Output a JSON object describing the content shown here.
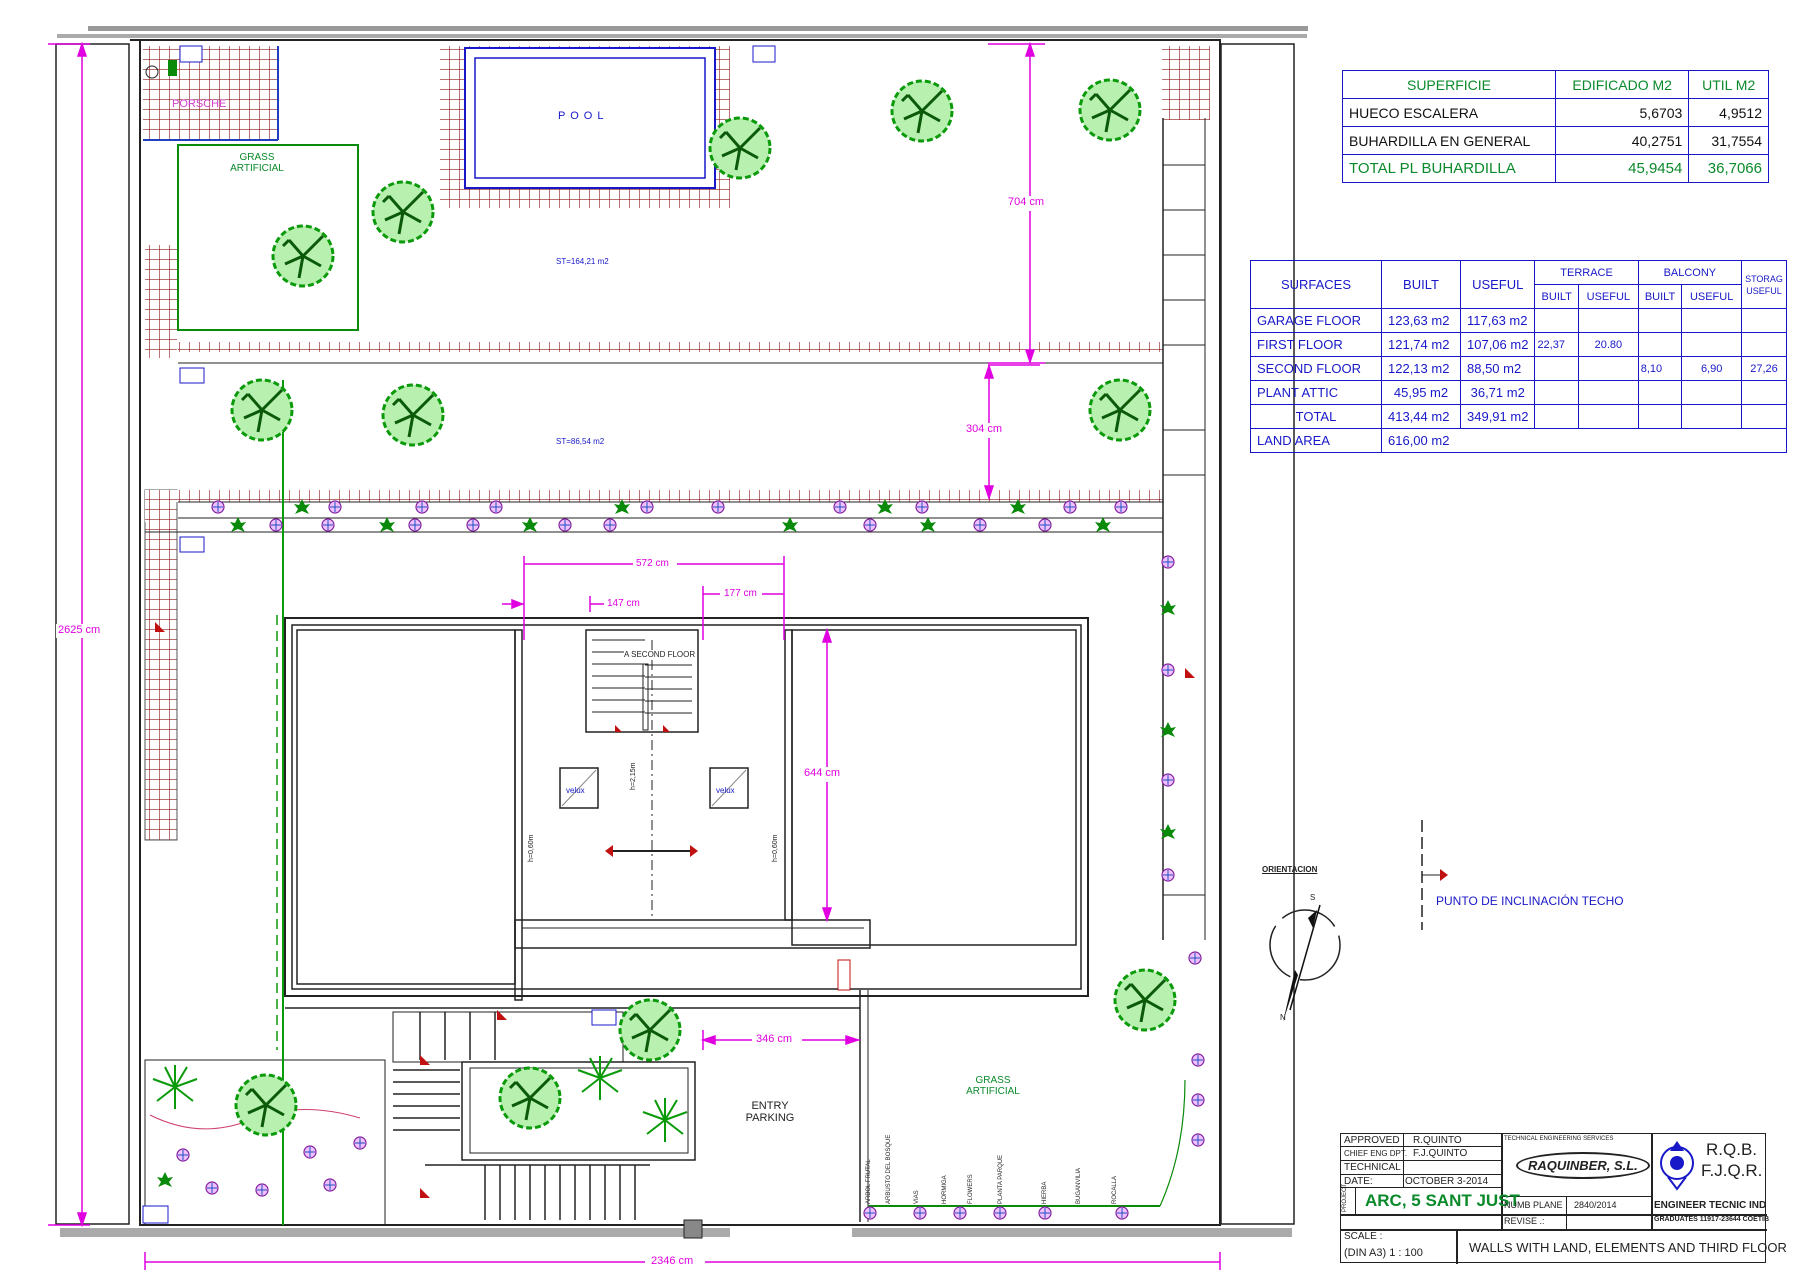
{
  "labels": {
    "porsche": "PORSCHE",
    "pool": "P O O L",
    "grass_artificial": "GRASS ARTIFICIAL",
    "st_upper": "ST=164,21 m2",
    "st_lower": "ST=86,54 m2",
    "second_floor_marker": "A SECOND FLOOR",
    "velux": "velux",
    "h_center": "h=2,15m",
    "h_left": "h=0,60m",
    "h_right": "h=0,60m",
    "entry_parking": "ENTRY PARKING",
    "grass_artificial_2": "GRASS ARTIFICIAL",
    "orientacion": "ORIENTACION",
    "north": "N",
    "south": "S",
    "punto_inclinacion": "PUNTO DE INCLINACIÓN TECHO"
  },
  "dimensions": {
    "overall_height": "2625 cm",
    "overall_width": "2346 cm",
    "upper_garden": "704 cm",
    "middle_garden": "304 cm",
    "stair_span": "572 cm",
    "stair_left": "147 cm",
    "stair_right": "177 cm",
    "attic_depth": "644 cm",
    "entry_width": "346 cm"
  },
  "plant_labels": [
    "ARBOL FRUTAL",
    "ARBUSTO DEL BOSQUE",
    "VIAS",
    "HORMIGA",
    "FLOWERS",
    "PLANTA PARQUE",
    "HIERBA",
    "BUGANVILIA",
    "ROCALLA"
  ],
  "superficie": {
    "headers": [
      "SUPERFICIE",
      "EDIFICADO M2",
      "UTIL M2"
    ],
    "rows": [
      {
        "name": "HUECO ESCALERA",
        "built": "5,6703",
        "useful": "4,9512"
      },
      {
        "name": "BUHARDILLA EN GENERAL",
        "built": "40,2751",
        "useful": "31,7554"
      }
    ],
    "total": {
      "name": "TOTAL PL BUHARDILLA",
      "built": "45,9454",
      "useful": "36,7066"
    }
  },
  "surfaces": {
    "headers": {
      "surfaces": "SURFACES",
      "built": "BUILT",
      "useful": "USEFUL",
      "terrace": "TERRACE",
      "balcony": "BALCONY",
      "storage": "STORAG USEFUL",
      "sub_built": "BUILT",
      "sub_useful": "USEFUL"
    },
    "rows": [
      {
        "name": "GARAGE FLOOR",
        "built": "123,63 m2",
        "useful": "117,63 m2",
        "t_built": "",
        "t_useful": "",
        "b_built": "",
        "b_useful": "",
        "storage": ""
      },
      {
        "name": "FIRST FLOOR",
        "built": "121,74 m2",
        "useful": "107,06 m2",
        "t_built": "22,37",
        "t_useful": "20.80",
        "b_built": "",
        "b_useful": "",
        "storage": ""
      },
      {
        "name": "SECOND FLOOR",
        "built": "122,13 m2",
        "useful": "88,50 m2",
        "t_built": "",
        "t_useful": "",
        "b_built": "8,10",
        "b_useful": "6,90",
        "storage": "27,26"
      },
      {
        "name": "PLANT ATTIC",
        "built": "45,95 m2",
        "useful": "36,71 m2",
        "t_built": "",
        "t_useful": "",
        "b_built": "",
        "b_useful": "",
        "storage": ""
      }
    ],
    "total": {
      "name": "TOTAL",
      "built": "413,44 m2",
      "useful": "349,91 m2"
    },
    "land": {
      "name": "LAND  AREA",
      "value": "616,00 m2"
    }
  },
  "title_block": {
    "approved_label": "APPROVED",
    "approved": "R.QUINTO",
    "chief_label": "CHIEF ENG DPT.",
    "chief": "F.J.QUINTO",
    "technical_label": "TECHNICAL",
    "date_label": "DATE:",
    "date": "OCTOBER 3-2014",
    "project_label": "PROJECT",
    "project": "ARC, 5  SANT JUST",
    "scale_label": "SCALE :",
    "scale_value": "(DIN A3)   1 : 100",
    "services": "TECHNICAL ENGINEERING SERVICES",
    "company": "RAQUINBER, S.L.",
    "numb_plane_label": "NUMB PLANE",
    "numb_plane": "2840/2014",
    "revise_label": "REVISE .:",
    "engineer": "ENGINEER TECNIC IND",
    "graduates": "GRADUATES 11917-23644 COETIB",
    "initials_1": "R.Q.B.",
    "initials_2": "F.J.Q.R.",
    "drawing_title": "WALLS WITH LAND, ELEMENTS AND THIRD FLOOR"
  },
  "colors": {
    "wall": "#222222",
    "dimension": "#e000e0",
    "tile": "#8b1a1a",
    "tree": "#0a9a0a",
    "table": "#1818c8",
    "label_green": "#0a8a2a"
  }
}
